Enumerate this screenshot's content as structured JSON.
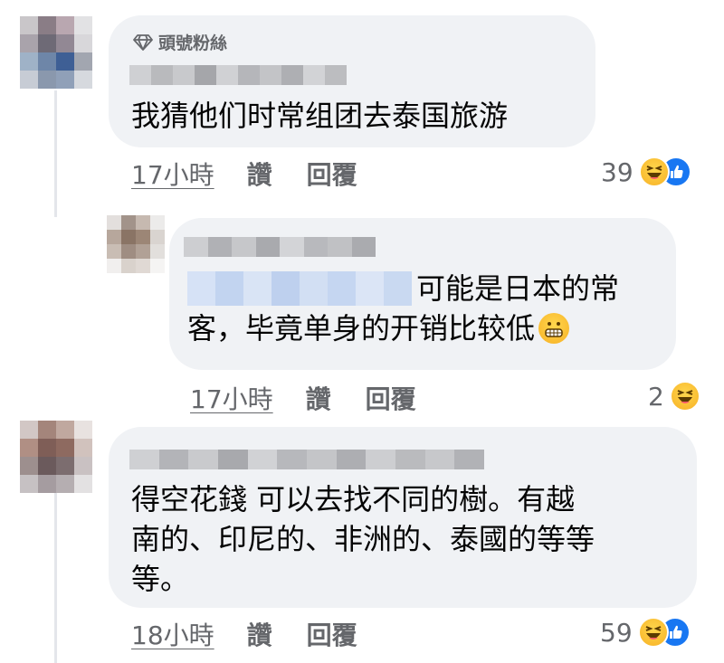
{
  "comments": [
    {
      "badge": "頭號粉絲",
      "text_lines": [
        "我猜他们时常组团去泰国旅游"
      ],
      "time": "17小時",
      "like_label": "讚",
      "reply_label": "回覆",
      "reaction_count": "39",
      "reactions": [
        "haha-icon",
        "like-icon"
      ]
    },
    {
      "text_lines": [
        "可能是日本的常",
        "客，毕竟单身的开销比较低"
      ],
      "inline_emoji": "grimacing-emoji-icon",
      "time": "17小時",
      "like_label": "讚",
      "reply_label": "回覆",
      "reaction_count": "2",
      "reactions": [
        "haha-icon"
      ]
    },
    {
      "text_lines": [
        "得空花錢 可以去找不同的樹。有越",
        "南的、印尼的、非洲的、泰國的等等",
        "等。"
      ],
      "time": "18小時",
      "like_label": "讚",
      "reply_label": "回覆",
      "reaction_count": "59",
      "reactions": [
        "haha-icon",
        "like-icon"
      ]
    }
  ],
  "colors": {
    "bubble": "#f0f2f5",
    "meta_text": "#65676b",
    "body_text": "#050505",
    "like_blue": "#1877f2",
    "haha_yellow": "#f7b125"
  }
}
